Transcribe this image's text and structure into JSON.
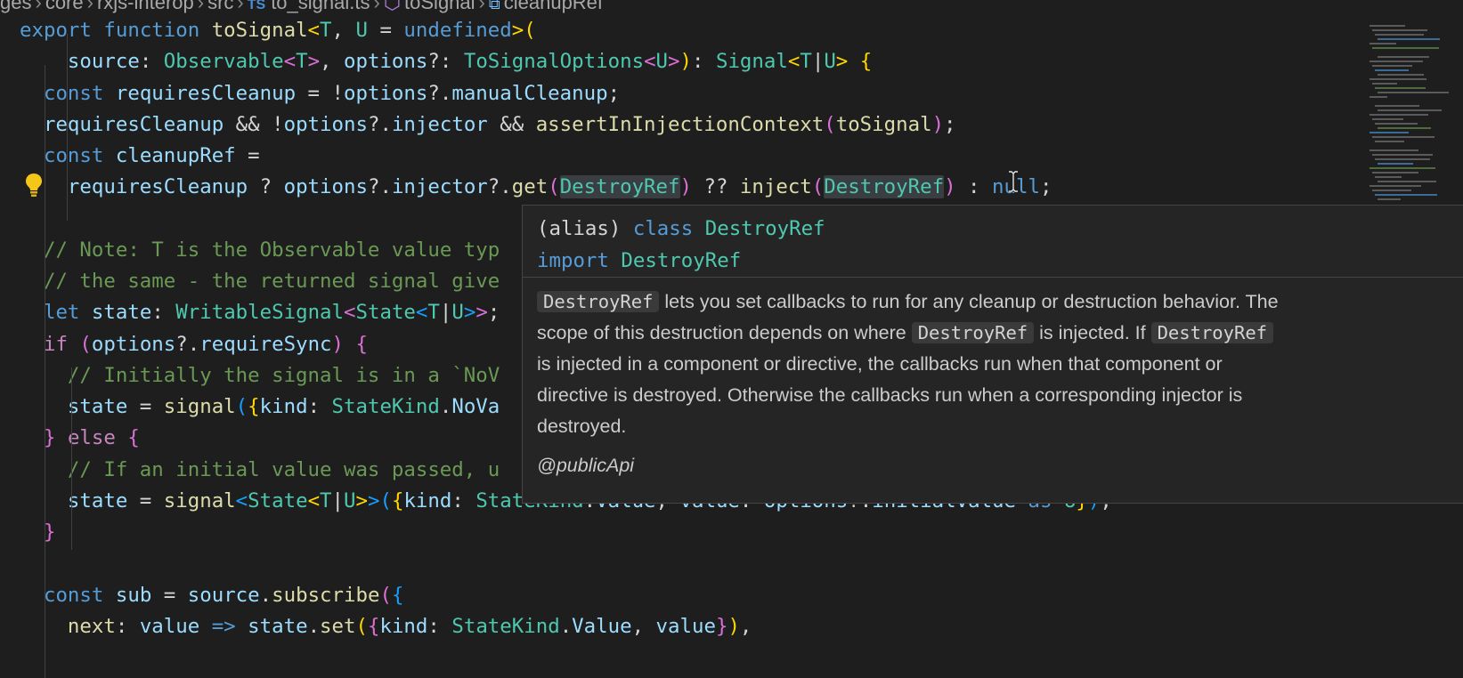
{
  "breadcrumb": {
    "items": [
      "ges",
      "core",
      "rxjs-interop",
      "src"
    ],
    "file_badge": "TS",
    "file": "to_signal.ts",
    "function": "toSignal",
    "variable": "cleanupRef"
  },
  "code_lines": [
    [
      [
        "kw",
        "export"
      ],
      [
        "txt",
        " "
      ],
      [
        "kw",
        "function"
      ],
      [
        "txt",
        " "
      ],
      [
        "fn",
        "toSignal"
      ],
      [
        "br1",
        "<"
      ],
      [
        "ty",
        "T"
      ],
      [
        "txt",
        ", "
      ],
      [
        "ty",
        "U"
      ],
      [
        "txt",
        " = "
      ],
      [
        "kw",
        "undefined"
      ],
      [
        "br1",
        ">("
      ]
    ],
    [
      [
        "txt",
        "    "
      ],
      [
        "var",
        "source"
      ],
      [
        "txt",
        ": "
      ],
      [
        "ty",
        "Observable"
      ],
      [
        "br2",
        "<"
      ],
      [
        "ty",
        "T"
      ],
      [
        "br2",
        ">"
      ],
      [
        "txt",
        ", "
      ],
      [
        "var",
        "options"
      ],
      [
        "txt",
        "?: "
      ],
      [
        "ty",
        "ToSignalOptions"
      ],
      [
        "br2",
        "<"
      ],
      [
        "ty",
        "U"
      ],
      [
        "br2",
        ">"
      ],
      [
        "br1",
        ")"
      ],
      [
        "txt",
        ": "
      ],
      [
        "ty",
        "Signal"
      ],
      [
        "br1",
        "<"
      ],
      [
        "ty",
        "T"
      ],
      [
        "txt",
        "|"
      ],
      [
        "ty",
        "U"
      ],
      [
        "br1",
        "> {"
      ]
    ],
    [
      [
        "txt",
        "  "
      ],
      [
        "kw",
        "const"
      ],
      [
        "txt",
        " "
      ],
      [
        "var",
        "requiresCleanup"
      ],
      [
        "txt",
        " = !"
      ],
      [
        "var",
        "options"
      ],
      [
        "txt",
        "?."
      ],
      [
        "var",
        "manualCleanup"
      ],
      [
        "txt",
        ";"
      ]
    ],
    [
      [
        "txt",
        "  "
      ],
      [
        "var",
        "requiresCleanup"
      ],
      [
        "txt",
        " && !"
      ],
      [
        "var",
        "options"
      ],
      [
        "txt",
        "?."
      ],
      [
        "var",
        "injector"
      ],
      [
        "txt",
        " && "
      ],
      [
        "fn",
        "assertInInjectionContext"
      ],
      [
        "br2",
        "("
      ],
      [
        "fn",
        "toSignal"
      ],
      [
        "br2",
        ")"
      ],
      [
        "txt",
        ";"
      ]
    ],
    [
      [
        "txt",
        "  "
      ],
      [
        "kw",
        "const"
      ],
      [
        "txt",
        " "
      ],
      [
        "var",
        "cleanupRef"
      ],
      [
        "txt",
        " ="
      ]
    ],
    [
      [
        "txt",
        "    "
      ],
      [
        "var",
        "requiresCleanup"
      ],
      [
        "txt",
        " ? "
      ],
      [
        "var",
        "options"
      ],
      [
        "txt",
        "?."
      ],
      [
        "var",
        "injector"
      ],
      [
        "txt",
        "?."
      ],
      [
        "fn",
        "get"
      ],
      [
        "br2",
        "("
      ],
      [
        "ty hl",
        "DestroyRef"
      ],
      [
        "br2",
        ")"
      ],
      [
        "txt",
        " ?? "
      ],
      [
        "fn",
        "inject"
      ],
      [
        "br2",
        "("
      ],
      [
        "ty hl",
        "DestroyRef"
      ],
      [
        "br2",
        ")"
      ],
      [
        "txt",
        " : "
      ],
      [
        "kw",
        "null"
      ],
      [
        "txt",
        ";"
      ]
    ],
    [],
    [
      [
        "txt",
        "  "
      ],
      [
        "cm",
        "// Note: T is the Observable value typ"
      ]
    ],
    [
      [
        "txt",
        "  "
      ],
      [
        "cm",
        "// the same - the returned signal give"
      ]
    ],
    [
      [
        "txt",
        "  "
      ],
      [
        "kw",
        "let"
      ],
      [
        "txt",
        " "
      ],
      [
        "var",
        "state"
      ],
      [
        "txt",
        ": "
      ],
      [
        "ty",
        "WritableSignal"
      ],
      [
        "br2",
        "<"
      ],
      [
        "ty",
        "State"
      ],
      [
        "br3",
        "<"
      ],
      [
        "ty",
        "T"
      ],
      [
        "txt",
        "|"
      ],
      [
        "ty",
        "U"
      ],
      [
        "br3",
        ">"
      ],
      [
        "br2",
        ">"
      ],
      [
        "txt",
        ";"
      ]
    ],
    [
      [
        "txt",
        "  "
      ],
      [
        "ctrl",
        "if"
      ],
      [
        "txt",
        " "
      ],
      [
        "br2",
        "("
      ],
      [
        "var",
        "options"
      ],
      [
        "txt",
        "?."
      ],
      [
        "var",
        "requireSync"
      ],
      [
        "br2",
        ")"
      ],
      [
        "txt",
        " "
      ],
      [
        "br2",
        "{"
      ]
    ],
    [
      [
        "txt",
        "    "
      ],
      [
        "cm",
        "// Initially the signal is in a `NoV"
      ]
    ],
    [
      [
        "txt",
        "    "
      ],
      [
        "var",
        "state"
      ],
      [
        "txt",
        " = "
      ],
      [
        "fn",
        "signal"
      ],
      [
        "br3",
        "("
      ],
      [
        "br1",
        "{"
      ],
      [
        "var",
        "kind"
      ],
      [
        "txt",
        ": "
      ],
      [
        "ty",
        "StateKind"
      ],
      [
        "txt",
        "."
      ],
      [
        "var",
        "NoVa"
      ]
    ],
    [
      [
        "txt",
        "  "
      ],
      [
        "br2",
        "}"
      ],
      [
        "txt",
        " "
      ],
      [
        "ctrl",
        "else"
      ],
      [
        "txt",
        " "
      ],
      [
        "br2",
        "{"
      ]
    ],
    [
      [
        "txt",
        "    "
      ],
      [
        "cm",
        "// If an initial value was passed, u"
      ]
    ],
    [
      [
        "txt",
        "    "
      ],
      [
        "var",
        "state"
      ],
      [
        "txt",
        " = "
      ],
      [
        "fn",
        "signal"
      ],
      [
        "br3",
        "<"
      ],
      [
        "ty",
        "State"
      ],
      [
        "br1",
        "<"
      ],
      [
        "ty",
        "T"
      ],
      [
        "txt",
        "|"
      ],
      [
        "ty",
        "U"
      ],
      [
        "br1",
        ">"
      ],
      [
        "br3",
        ">"
      ],
      [
        "br3",
        "("
      ],
      [
        "br1",
        "{"
      ],
      [
        "var",
        "kind"
      ],
      [
        "txt",
        ": "
      ],
      [
        "ty",
        "StateKind"
      ],
      [
        "txt",
        "."
      ],
      [
        "var",
        "Value"
      ],
      [
        "txt",
        ", "
      ],
      [
        "var",
        "value"
      ],
      [
        "txt",
        ": "
      ],
      [
        "var",
        "options"
      ],
      [
        "txt",
        "?."
      ],
      [
        "var",
        "initialValue"
      ],
      [
        "txt",
        " "
      ],
      [
        "kw",
        "as"
      ],
      [
        "txt",
        " "
      ],
      [
        "ty",
        "U"
      ],
      [
        "br1",
        "}"
      ],
      [
        "br3",
        ")"
      ],
      [
        "txt",
        ";"
      ]
    ],
    [
      [
        "txt",
        "  "
      ],
      [
        "br2",
        "}"
      ]
    ],
    [],
    [
      [
        "txt",
        "  "
      ],
      [
        "kw",
        "const"
      ],
      [
        "txt",
        " "
      ],
      [
        "var",
        "sub"
      ],
      [
        "txt",
        " = "
      ],
      [
        "var",
        "source"
      ],
      [
        "txt",
        "."
      ],
      [
        "fn",
        "subscribe"
      ],
      [
        "br2",
        "("
      ],
      [
        "br3",
        "{"
      ]
    ],
    [
      [
        "txt",
        "    "
      ],
      [
        "fn",
        "next"
      ],
      [
        "txt",
        ": "
      ],
      [
        "var",
        "value"
      ],
      [
        "txt",
        " "
      ],
      [
        "kw",
        "=>"
      ],
      [
        "txt",
        " "
      ],
      [
        "var",
        "state"
      ],
      [
        "txt",
        "."
      ],
      [
        "fn",
        "set"
      ],
      [
        "br1",
        "("
      ],
      [
        "br2",
        "{"
      ],
      [
        "var",
        "kind"
      ],
      [
        "txt",
        ": "
      ],
      [
        "ty",
        "StateKind"
      ],
      [
        "txt",
        "."
      ],
      [
        "var",
        "Value"
      ],
      [
        "txt",
        ", "
      ],
      [
        "var",
        "value"
      ],
      [
        "br2",
        "}"
      ],
      [
        "br1",
        ")"
      ],
      [
        "txt",
        ","
      ]
    ]
  ],
  "hover": {
    "signature_line1": [
      [
        "txt",
        "(alias) "
      ],
      [
        "kw",
        "class"
      ],
      [
        "txt",
        " "
      ],
      [
        "ty",
        "DestroyRef"
      ]
    ],
    "signature_line2": [
      [
        "kw",
        "import"
      ],
      [
        "txt",
        " "
      ],
      [
        "ty",
        "DestroyRef"
      ]
    ],
    "doc_lines": [
      [
        [
          "code",
          "DestroyRef"
        ],
        [
          "text",
          " lets you set callbacks to run for any cleanup or destruction behavior. The"
        ]
      ],
      [
        [
          "text",
          "scope of this destruction depends on where "
        ],
        [
          "code",
          "DestroyRef"
        ],
        [
          "text",
          " is injected. If "
        ],
        [
          "code",
          "DestroyRef"
        ]
      ],
      [
        [
          "text",
          "is injected in a component or directive, the callbacks run when that component or"
        ]
      ],
      [
        [
          "text",
          "directive is destroyed. Otherwise the callbacks run when a corresponding injector is"
        ]
      ],
      [
        [
          "text",
          "destroyed."
        ]
      ]
    ],
    "tag": "@publicApi"
  },
  "icons": {
    "lightbulb": "lightbulb-icon",
    "cursor": "text-cursor-icon"
  },
  "colors": {
    "background": "#1e1e1e",
    "keyword": "#569cd6",
    "type": "#4ec9b0",
    "function": "#dcdcaa",
    "variable": "#9cdcfe",
    "comment": "#6a9955"
  }
}
